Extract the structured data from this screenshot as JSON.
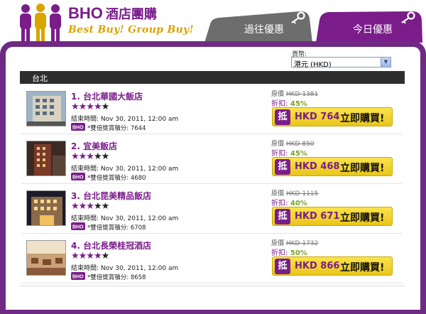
{
  "logo": {
    "brand": "BHO",
    "chinese": "酒店團購",
    "slogan": "Best Buy! Group Buy!"
  },
  "tabs": [
    {
      "label": "過往優惠",
      "icon": "key-icon"
    },
    {
      "label": "今日優惠",
      "icon": "key-icon"
    }
  ],
  "currency": {
    "label": "貨幣:",
    "selected": "港元 (HKD)"
  },
  "city": "台北",
  "labels": {
    "original_price": "原價",
    "discount": "折扣:",
    "end_time": "結束時間:",
    "points": "*雙倍獎賞積分:",
    "buy_now": "立即購買!",
    "buy_mark": "抵",
    "bho_badge": "BHO"
  },
  "colors": {
    "brand_purple": "#7a1d8a",
    "frame_purple": "#6f2a83",
    "button_yellow": "#f2d43a",
    "discount_green": "#7aa02a",
    "slogan_gold": "#d9a400"
  },
  "hotels": [
    {
      "name": "1. 台北華國大飯店",
      "stars": 4,
      "end_time": "Nov 30, 2011, 12:00 am",
      "points": "7644",
      "orig_price": "HKD 1381",
      "discount": "45%",
      "price": "HKD 764"
    },
    {
      "name": "2. 宜美飯店",
      "stars": 3,
      "end_time": "Nov 30, 2011, 12:00 am",
      "points": "4680",
      "orig_price": "HKD 850",
      "discount": "45%",
      "price": "HKD 468"
    },
    {
      "name": "3. 台北昆美精品飯店",
      "stars": 3,
      "end_time": "Nov 30, 2011, 12:00 am",
      "points": "6708",
      "orig_price": "HKD 1115",
      "discount": "40%",
      "price": "HKD 671"
    },
    {
      "name": "4. 台北長榮桂冠酒店",
      "stars": 4,
      "end_time": "Nov 30, 2011, 12:00 am",
      "points": "8658",
      "orig_price": "HKD 1732",
      "discount": "50%",
      "price": "HKD 866"
    }
  ]
}
